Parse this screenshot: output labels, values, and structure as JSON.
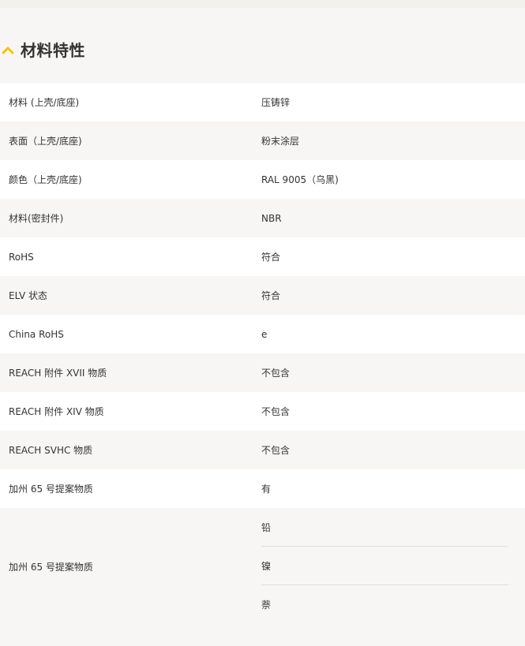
{
  "section": {
    "title": "材料特性",
    "icon": "chevron-up-icon",
    "accent_color": "#f5c400"
  },
  "rows": [
    {
      "label": "材料 (上壳/底座)",
      "value": "压铸锌"
    },
    {
      "label": "表面（上壳/底座)",
      "value": "粉末涂层"
    },
    {
      "label": "颜色（上壳/底座)",
      "value": "RAL 9005（乌黑)"
    },
    {
      "label": "材料(密封件)",
      "value": "NBR"
    },
    {
      "label": "RoHS",
      "value": "符合"
    },
    {
      "label": "ELV 状态",
      "value": "符合"
    },
    {
      "label": "China RoHS",
      "value": "e"
    },
    {
      "label": "REACH 附件 XVII 物质",
      "value": "不包含"
    },
    {
      "label": "REACH 附件 XIV 物质",
      "value": "不包含"
    },
    {
      "label": "REACH SVHC 物质",
      "value": "不包含"
    },
    {
      "label": "加州 65 号提案物质",
      "value": "有"
    }
  ],
  "multi_row": {
    "label": "加州 65 号提案物质",
    "values": [
      "铅",
      "镍",
      "萘"
    ]
  }
}
